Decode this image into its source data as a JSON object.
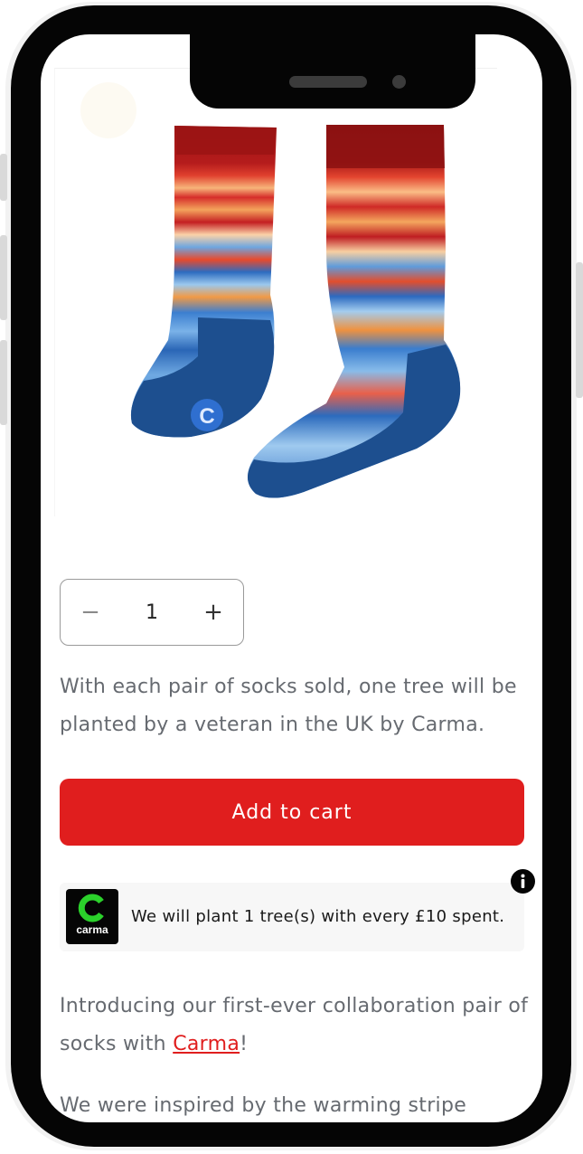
{
  "product": {
    "image_alt": "Warming stripes socks",
    "logo_mark": "C"
  },
  "quantity": {
    "decrease": "−",
    "value": "1",
    "increase": "+"
  },
  "tree_note": "With each pair of socks sold, one tree will be planted by a veteran in the UK by Carma.",
  "add_to_cart": "Add to cart",
  "carma_widget": {
    "logo_text": "carma",
    "message": "We will plant 1 tree(s) with every £10 spent."
  },
  "description": {
    "intro_before_link": "Introducing our first-ever collaboration pair of socks with ",
    "link_text": "Carma",
    "intro_after_link": "!",
    "second_line": "We were inspired by the warming stripe"
  },
  "colors": {
    "accent": "#e01e1e",
    "carma_green": "#2bd12b",
    "sock_navy": "#1e4e8c"
  }
}
